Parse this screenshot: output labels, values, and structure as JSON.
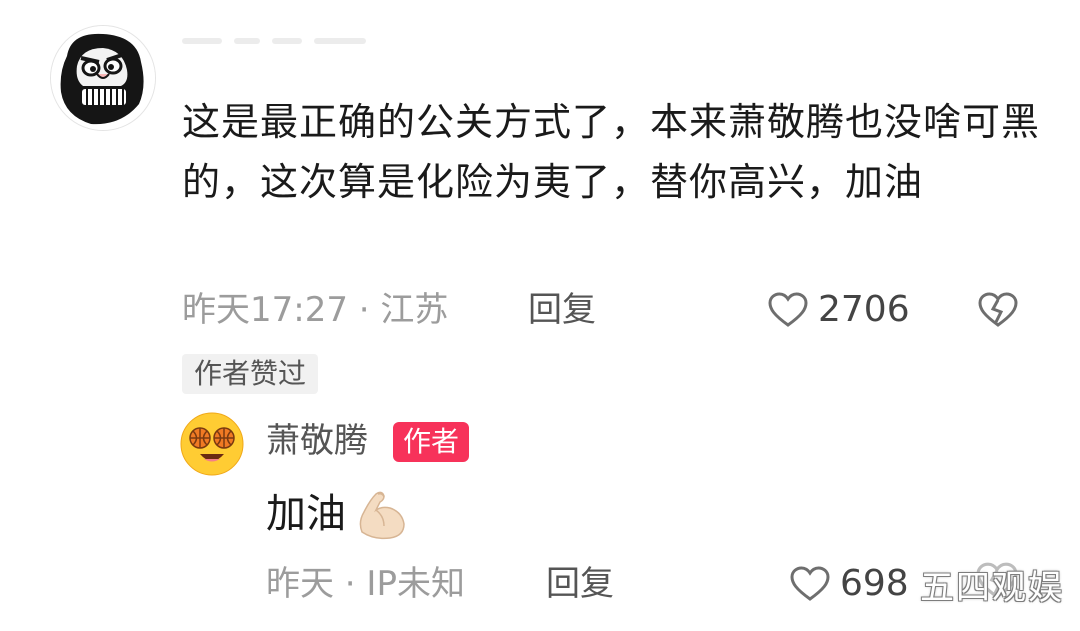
{
  "comment": {
    "text": "这是最正确的公关方式了，本来萧敬腾也没啥可黑的，这次算是化险为夷了，替你高兴，加油",
    "meta": "昨天17:27 · 江苏",
    "reply_label": "回复",
    "like_count": "2706",
    "author_liked_tag": "作者赞过",
    "avatar_icon": "cartoon-face-avatar-icon",
    "like_icon": "heart-outline-icon",
    "dislike_icon": "broken-heart-icon"
  },
  "reply": {
    "username": "萧敬腾",
    "badge": "作者",
    "text": "加油",
    "emoji_icon": "flexed-biceps-emoji-icon",
    "meta": "昨天 · IP未知",
    "reply_label": "回复",
    "like_count": "698",
    "avatar_icon": "basketball-eyes-emoji-avatar-icon"
  },
  "watermark": "五四观娱",
  "colors": {
    "author_badge": "#f7325a",
    "meta_gray": "#9c9c9c"
  }
}
